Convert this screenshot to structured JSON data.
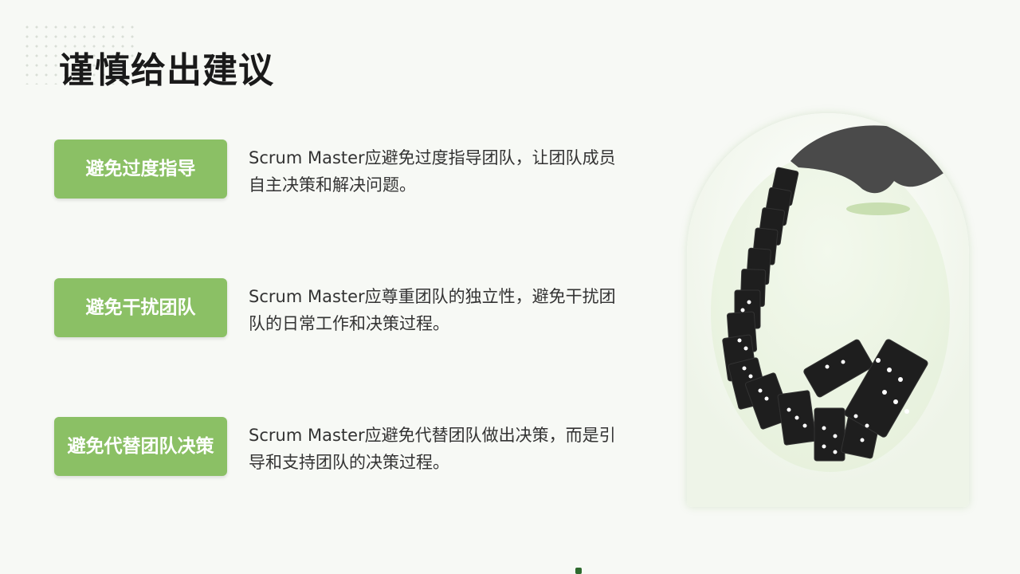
{
  "page": {
    "title": "谨慎给出建议"
  },
  "items": [
    {
      "label": "避免过度指导",
      "description": "Scrum  Master应避免过度指导团队，让团队成员自主决策和解决问题。"
    },
    {
      "label": "避免干扰团队",
      "description": "Scrum  Master应尊重团队的独立性，避免干扰团队的日常工作和决策过程。"
    },
    {
      "label": "避免代替团队决策",
      "description": "Scrum  Master应避免代替团队做出决策，而是引导和支持团队的决策过程。"
    }
  ],
  "image": {
    "subject": "falling-dominoes-with-hand-photo"
  },
  "colors": {
    "accent": "#8bc065",
    "background": "#f7f9f5",
    "title_text": "#1a1a1a",
    "body_text": "#333333"
  }
}
